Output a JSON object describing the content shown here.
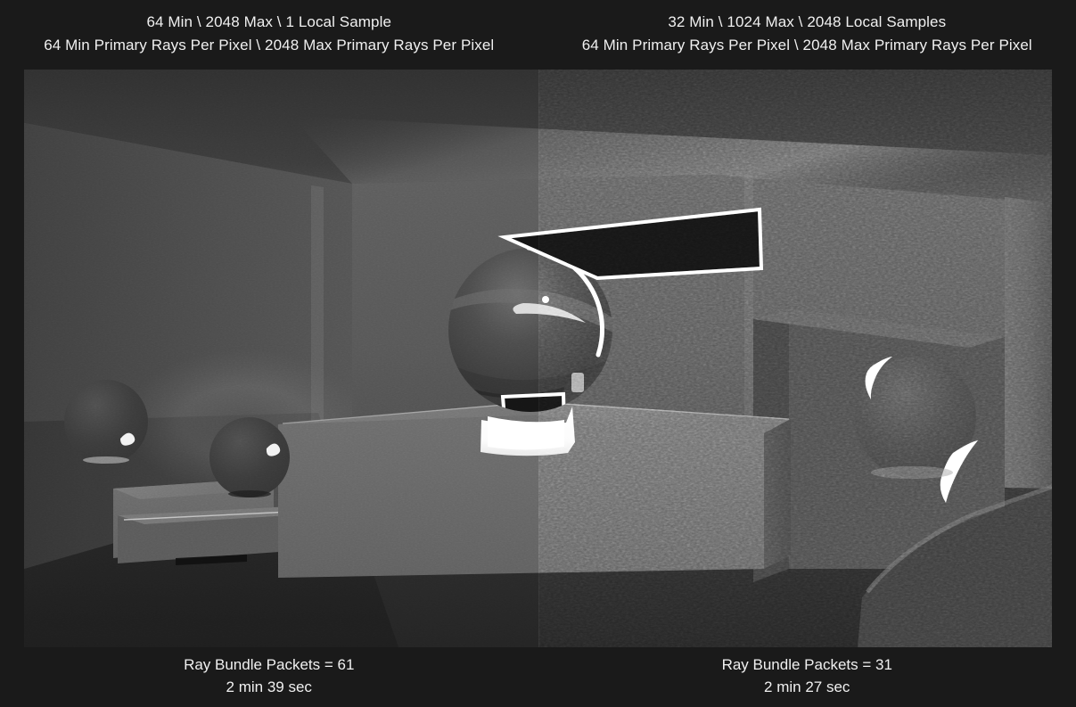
{
  "panels": {
    "left": {
      "header_line1": "64 Min \\ 2048 Max \\ 1 Local Sample",
      "header_line2": "64 Min Primary Rays Per Pixel \\ 2048 Max Primary Rays Per Pixel",
      "footer_line1": "Ray Bundle Packets = 61",
      "footer_line2": "2 min 39 sec"
    },
    "right": {
      "header_line1": "32 Min \\ 1024 Max \\ 2048 Local Samples",
      "header_line2": "64 Min Primary Rays Per Pixel \\ 2048 Max Primary Rays Per Pixel",
      "footer_line1": "Ray Bundle Packets = 31",
      "footer_line2": "2 min 27 sec"
    }
  },
  "render": {
    "title": "Ray Bundle Render Comparison",
    "description": "Side-by-side path traced Cornell-style room with reflective spheres, pedestals and an area light quad outlined in white",
    "colors": {
      "page_background": "#1a1a1a",
      "text": "#f0f0f0",
      "wall_back": "#555555",
      "wall_left": "#4e4e4e",
      "wall_right": "#5a5a5a",
      "ceiling": "#3a3a3a",
      "floor": "#2a2a2a",
      "pedestal_top": "#6e6e6e",
      "pedestal_front": "#636363",
      "pedestal_side": "#4a4a4a",
      "light_quad_fill": "#111111",
      "light_quad_outline": "#ffffff",
      "sphere_body": "#3e3e3e",
      "caustic": "#ffffff"
    },
    "elements": {
      "light_quad_label": "area-light-quad",
      "sphere_center_label": "center-reflective-sphere",
      "sphere_left_far_label": "left-far-sphere",
      "sphere_left_near_label": "left-near-sphere",
      "sphere_right_label": "right-sphere",
      "caustic_label": "caustic-highlight",
      "glow_label": "soft-wall-glow"
    }
  }
}
